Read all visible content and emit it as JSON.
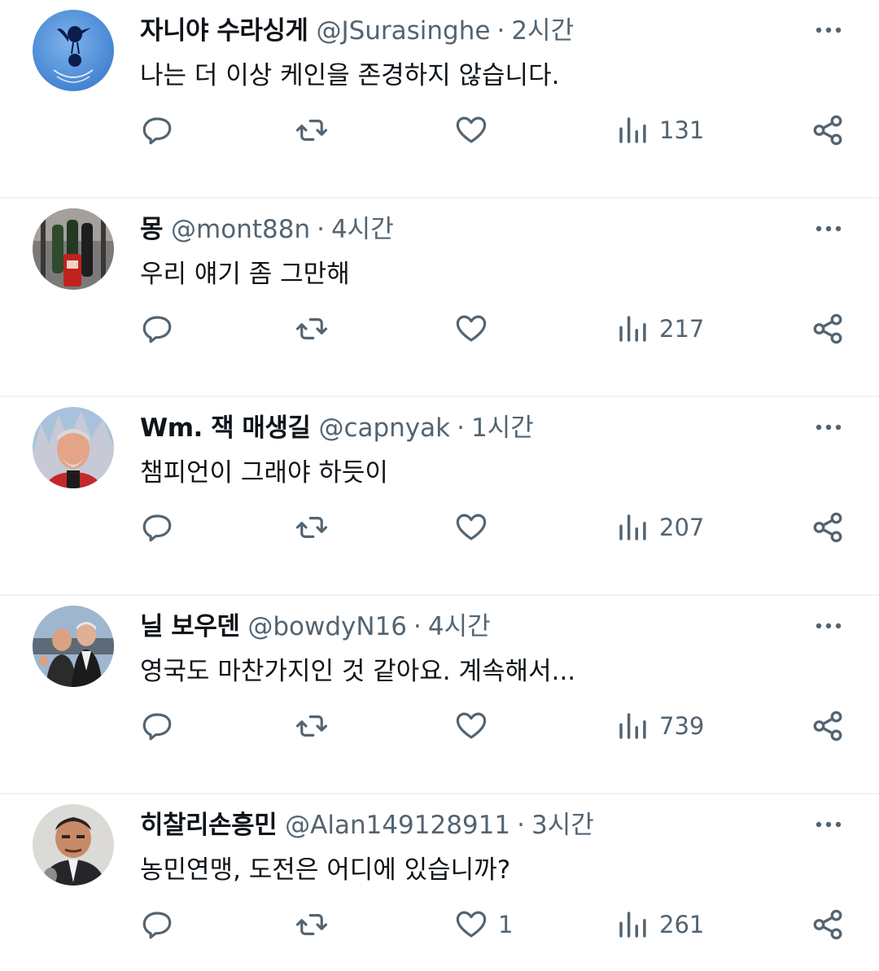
{
  "tweets": [
    {
      "name": "자니야 수라싱게",
      "handle": "@JSurasinghe",
      "separator": "·",
      "time": "2시간",
      "text": "나는 더 이상 케인을 존경하지 않습니다.",
      "likes": "",
      "views": "131",
      "avatar": "tottenham-crest"
    },
    {
      "name": "몽",
      "handle": "@mont88n",
      "separator": "·",
      "time": "4시간",
      "text": "우리 얘기 좀 그만해",
      "likes": "",
      "views": "217",
      "avatar": "bottles-photo"
    },
    {
      "name": "Wm. 잭 매생길",
      "handle": "@capnyak",
      "separator": "·",
      "time": "1시간",
      "text": "챔피언이 그래야 하듯이",
      "likes": "",
      "views": "207",
      "avatar": "man-at-castle-photo"
    },
    {
      "name": "닐 보우덴",
      "handle": "@bowdyN16",
      "separator": "·",
      "time": "4시간",
      "text": "영국도 마찬가지인 것 같아요. 계속해서...",
      "likes": "",
      "views": "739",
      "avatar": "two-men-photo"
    },
    {
      "name": "히찰리손흥민",
      "handle": "@Alan149128911",
      "separator": "·",
      "time": "3시간",
      "text": "농민연맹, 도전은 어디에 있습니까?",
      "likes": "1",
      "views": "261",
      "avatar": "cartoon-man-avatar"
    }
  ],
  "colors": {
    "text": "#0f1419",
    "secondary": "#536471",
    "divider": "#eff3f4",
    "spurs_blue": "#4a8fd6"
  }
}
